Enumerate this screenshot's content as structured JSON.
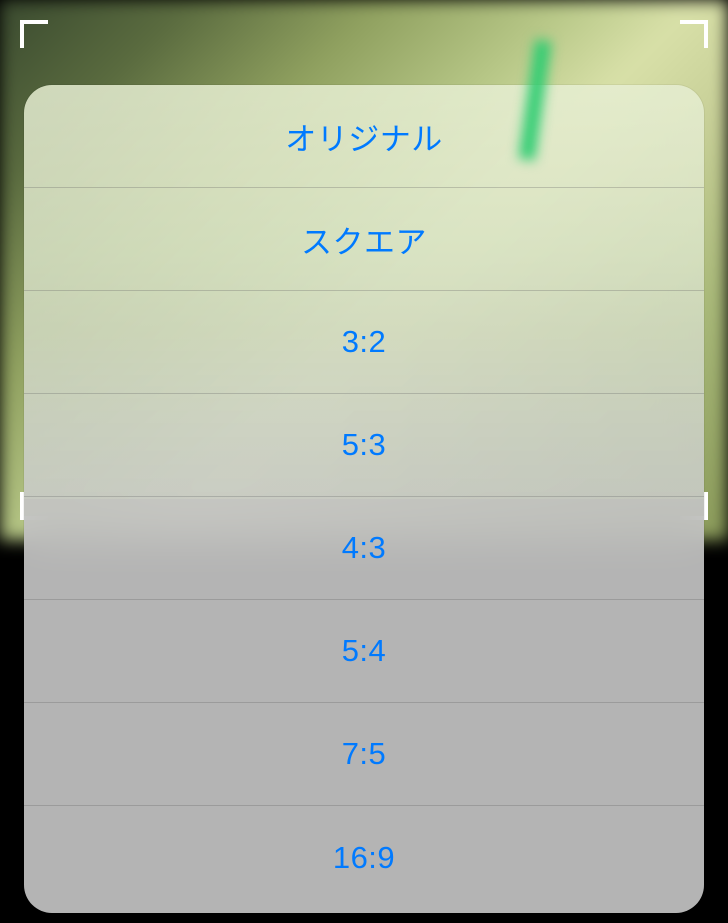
{
  "aspectRatios": {
    "items": [
      {
        "label": "オリジナル",
        "name": "aspect-ratio-original"
      },
      {
        "label": "スクエア",
        "name": "aspect-ratio-square"
      },
      {
        "label": "3:2",
        "name": "aspect-ratio-3-2"
      },
      {
        "label": "5:3",
        "name": "aspect-ratio-5-3"
      },
      {
        "label": "4:3",
        "name": "aspect-ratio-4-3"
      },
      {
        "label": "5:4",
        "name": "aspect-ratio-5-4"
      },
      {
        "label": "7:5",
        "name": "aspect-ratio-7-5"
      },
      {
        "label": "16:9",
        "name": "aspect-ratio-16-9"
      }
    ]
  }
}
